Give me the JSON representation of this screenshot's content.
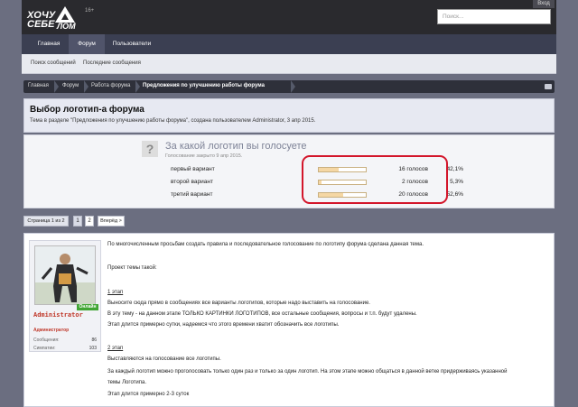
{
  "header": {
    "logo_line1": "ХОЧУ",
    "logo_line2": "СЕБЕ",
    "logo_line3": "ЛОМ",
    "age": "16+",
    "login": "Вход",
    "search_placeholder": "Поиск..."
  },
  "nav": {
    "tabs": [
      {
        "label": "Главная"
      },
      {
        "label": "Форум"
      },
      {
        "label": "Пользователи"
      }
    ],
    "sub": [
      {
        "label": "Поиск сообщений"
      },
      {
        "label": "Последние сообщения"
      }
    ]
  },
  "breadcrumb": [
    "Главная",
    "Форум",
    "Работа форума",
    "Предложения по улучшению работы форума"
  ],
  "thread": {
    "title": "Выбор логотип-а форума",
    "description": "Тема в разделе \"Предложения по улучшению работы форума\", создана пользователем Administrator, 3 апр 2015."
  },
  "poll": {
    "question": "За какой логотип вы голосуете",
    "status": "Голосование закрыто 9 апр 2015.",
    "options": [
      {
        "label": "первый вариант",
        "votes": "16 голосов",
        "percent": "42,1%",
        "fraction": 0.421
      },
      {
        "label": "второй вариант",
        "votes": "2 голосов",
        "percent": "5,3%",
        "fraction": 0.053
      },
      {
        "label": "третий вариант",
        "votes": "20 голосов",
        "percent": "52,6%",
        "fraction": 0.526
      }
    ]
  },
  "pager": {
    "info": "Страница 1 из 2",
    "pages": [
      "1",
      "2"
    ],
    "current": "1",
    "next": "Вперёд >"
  },
  "post": {
    "user": {
      "name": "Administrator",
      "title": "Администратор",
      "online": "Онлайн",
      "stats": [
        {
          "label": "Сообщения:",
          "value": "86"
        },
        {
          "label": "Симпатии:",
          "value": "103"
        }
      ]
    },
    "lines": [
      {
        "text": "По многочисленным просьбам создать правила и последовательное голосование по логотипу форума сделана данная тема."
      },
      {
        "text": "Проект темы такой:"
      },
      {
        "text": "1 этап"
      },
      {
        "text": "Выносите сюда прямо в сообщениях все варианты логотипов, которые надо выставить на голосование."
      },
      {
        "text": "В эту тему - на данном этапе ТОЛЬКО КАРТИНКИ ЛОГОТИПОВ, все остальные сообщения, вопросы и т.п. будут удалены."
      },
      {
        "text": "Этап длится примерно сутки, надеемся что этого времени хватит обозначить все логотипы."
      },
      {
        "text": "2 этап"
      },
      {
        "text": "Выставляются на голосование все логотипы."
      },
      {
        "text": "За каждый логотип можно проголосовать только один раз и только за один логотип. На этом этапе можно общаться в данной ветке придерживаясь указанной"
      },
      {
        "text": "темы Логотипа."
      },
      {
        "text": "Этап длится примерно 2-3 суток"
      }
    ]
  }
}
